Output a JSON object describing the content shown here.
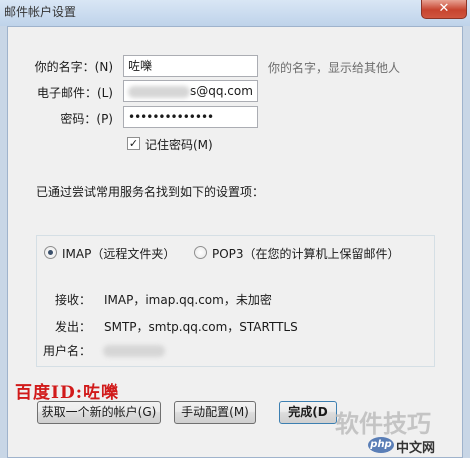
{
  "window": {
    "title": "邮件帐户设置",
    "close_glyph": "✕"
  },
  "form": {
    "name_label": "你的名字：(N)",
    "name_value": "咗嚛",
    "name_hint": "你的名字，显示给其他人",
    "email_label": "电子邮件：(L)",
    "email_value": "s@qq.com",
    "password_label": "密码：(P)",
    "password_value": "••••••••••••••",
    "remember_label": "记住密码(M)",
    "remember_checked": true
  },
  "found_message": "已通过尝试常用服务名找到如下的设置项：",
  "protocol": {
    "imap_label": "IMAP（远程文件夹）",
    "pop3_label": "POP3（在您的计算机上保留邮件）",
    "selected": "IMAP"
  },
  "details": {
    "incoming_label": "接收：",
    "incoming_value": "IMAP，imap.qq.com，未加密",
    "outgoing_label": "发出：",
    "outgoing_value": "SMTP，smtp.qq.com，STARTTLS",
    "username_label": "用户名："
  },
  "buttons": {
    "get_new_account": "获取一个新的帐户(G)",
    "manual_config": "手动配置(M)",
    "done": "完成(D"
  },
  "overlays": {
    "baidu_id": "百度ID:咗嚛",
    "site_watermark": "软件技巧",
    "php_logo": "php",
    "php_site": "中文网"
  }
}
